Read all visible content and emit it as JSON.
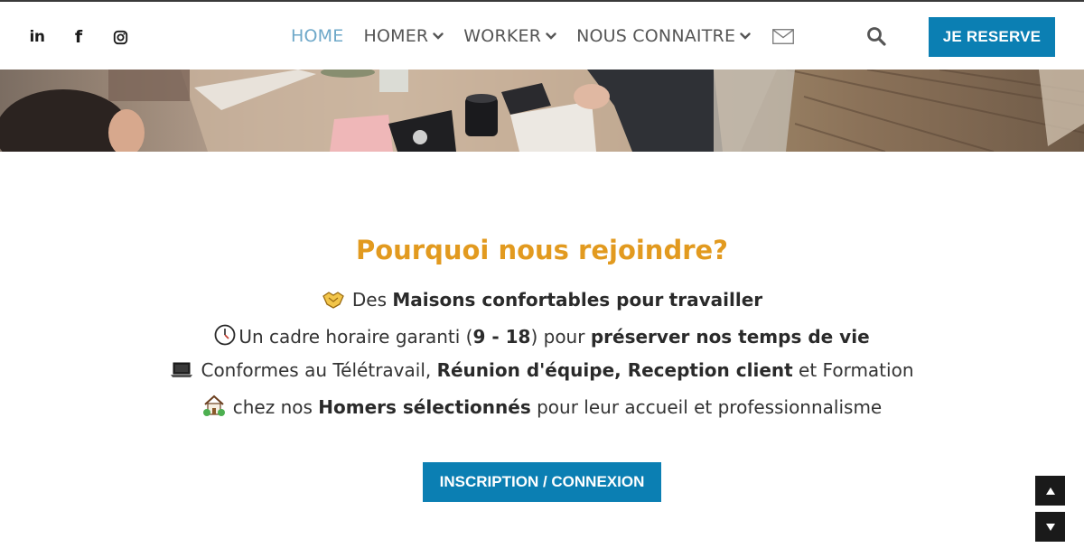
{
  "nav": {
    "items": [
      {
        "label": "HOME",
        "active": true,
        "has_dropdown": false
      },
      {
        "label": "HOMER",
        "active": false,
        "has_dropdown": true
      },
      {
        "label": "WORKER",
        "active": false,
        "has_dropdown": true
      },
      {
        "label": "NOUS CONNAITRE",
        "active": false,
        "has_dropdown": true
      }
    ]
  },
  "header": {
    "social": [
      {
        "icon": "linkedin-icon",
        "glyph": "in"
      },
      {
        "icon": "facebook-icon",
        "glyph": "f"
      },
      {
        "icon": "instagram-icon"
      }
    ],
    "reserve_label": "JE RESERVE"
  },
  "main": {
    "title": "Pourquoi nous rejoindre?",
    "lines": [
      {
        "icon": "handshake-icon",
        "parts": [
          "Des ",
          "Maisons confortables pour",
          " ",
          "travailler"
        ]
      },
      {
        "icon": "clock-icon",
        "parts": [
          "Un cadre horaire garanti (",
          "9 - 18",
          ") pour ",
          "préserver nos temps de vie"
        ]
      },
      {
        "icon": "laptop-icon",
        "parts": [
          "Conformes au Télétravail, ",
          "Réunion d'équipe, Reception client",
          " et Formation"
        ]
      },
      {
        "icon": "house-icon",
        "parts": [
          "chez nos ",
          "Homers sélectionnés",
          " pour leur accueil et professionnalisme"
        ]
      }
    ],
    "cta_label": "INSCRIPTION / CONNEXION"
  },
  "colors": {
    "accent": "#0b7fb3",
    "title": "#e29a1f",
    "nav_active": "#6ea8c9",
    "nav": "#555555"
  }
}
